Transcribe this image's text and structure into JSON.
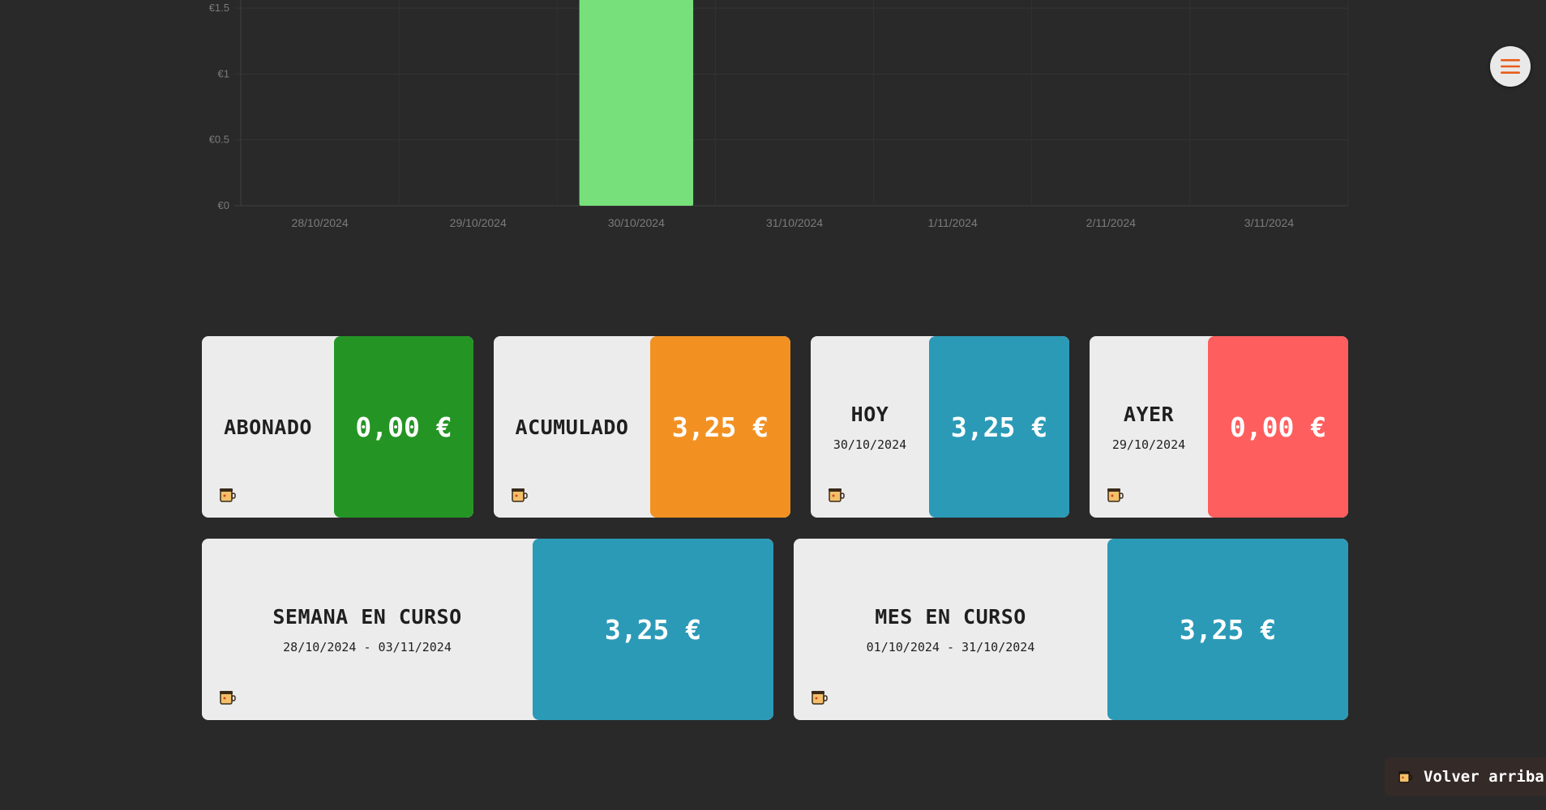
{
  "chart_data": {
    "type": "bar",
    "categories": [
      "28/10/2024",
      "29/10/2024",
      "30/10/2024",
      "31/10/2024",
      "1/11/2024",
      "2/11/2024",
      "3/11/2024"
    ],
    "values": [
      0,
      0,
      3.25,
      0,
      0,
      0,
      0
    ],
    "y_ticks": [
      "€0",
      "€0.5",
      "€1",
      "€1.5"
    ],
    "ylim": [
      0,
      1.5
    ],
    "bar_color": "#77e07b",
    "grid": true
  },
  "menu": {
    "icon": "hamburger-menu-icon",
    "icon_color": "#e85d1a"
  },
  "cards": {
    "abonado": {
      "title": "ABONADO",
      "value": "0,00 €",
      "color": "#249524"
    },
    "acumulado": {
      "title": "ACUMULADO",
      "value": "3,25 €",
      "color": "#f29122"
    },
    "hoy": {
      "title": "HOY",
      "date": "30/10/2024",
      "value": "3,25 €",
      "color": "#2b9ab7"
    },
    "ayer": {
      "title": "AYER",
      "date": "29/10/2024",
      "value": "0,00 €",
      "color": "#ff5e5e"
    },
    "semana": {
      "title": "SEMANA EN CURSO",
      "range": "28/10/2024 - 03/11/2024",
      "value": "3,25 €",
      "color": "#2b9ab7"
    },
    "mes": {
      "title": "MES EN CURSO",
      "range": "01/10/2024 - 31/10/2024",
      "value": "3,25 €",
      "color": "#2b9ab7"
    }
  },
  "back_to_top": {
    "label": "Volver arriba"
  }
}
